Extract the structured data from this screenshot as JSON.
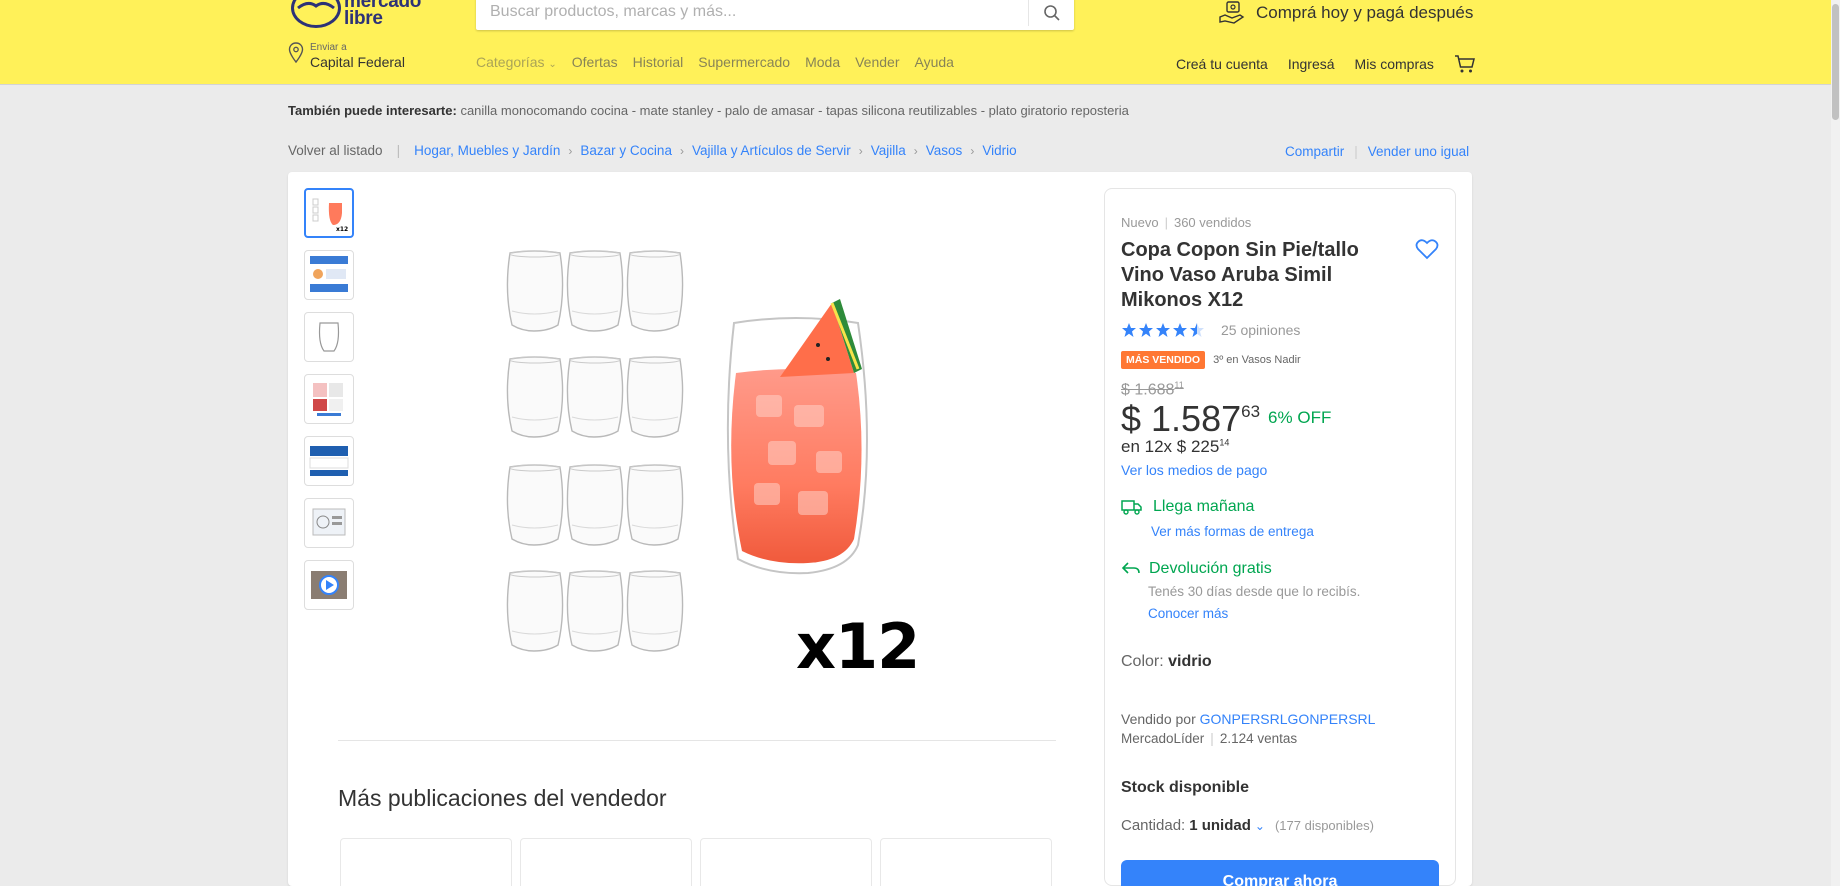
{
  "header": {
    "logo_text_line1": "mercado",
    "logo_text_line2": "libre",
    "search_placeholder": "Buscar productos, marcas y más...",
    "promo": "Comprá hoy y pagá después",
    "location_small": "Enviar a",
    "location_big": "Capital Federal",
    "nav": [
      "Categorías",
      "Ofertas",
      "Historial",
      "Supermercado",
      "Moda",
      "Vender",
      "Ayuda"
    ],
    "user_nav": [
      "Creá tu cuenta",
      "Ingresá",
      "Mis compras"
    ],
    "brand_color": "#fff159"
  },
  "suggestions": {
    "label": "También puede interesarte:",
    "items": "canilla monocomando cocina - mate stanley - palo de amasar - tapas silicona reutilizables - plato giratorio reposteria"
  },
  "breadcrumb": {
    "back": "Volver al listado",
    "items": [
      "Hogar, Muebles y Jardín",
      "Bazar y Cocina",
      "Vajilla y Artículos de Servir",
      "Vajilla",
      "Vasos",
      "Vidrio"
    ],
    "share": "Compartir",
    "sell": "Vender uno igual"
  },
  "gallery": {
    "badge_text": "x12"
  },
  "more": {
    "title": "Más publicaciones del vendedor"
  },
  "product": {
    "condition": "Nuevo",
    "sold": "360 vendidos",
    "title": "Copa Copon Sin Pie/tallo Vino Vaso Aruba Simil Mikonos X12",
    "rating": 4.5,
    "reviews": "25 opiniones",
    "badge": "MÁS VENDIDO",
    "rank": "3º en Vasos Nadir",
    "old_price": "$ 1.688",
    "old_price_cents": "11",
    "price": "$ 1.587",
    "price_cents": "63",
    "discount": "6% OFF",
    "installments": "en 12x $ 225",
    "installments_cents": "14",
    "payment_link": "Ver los medios de pago",
    "shipping": "Llega mañana",
    "shipping_link": "Ver más formas de entrega",
    "return_title": "Devolución gratis",
    "return_sub": "Tenés 30 días desde que lo recibís.",
    "return_link": "Conocer más",
    "color_label": "Color:",
    "color_value": "vidrio",
    "seller_label": "Vendido por",
    "seller_name": "GONPERSRLGONPERSRL",
    "seller_tag": "MercadoLíder",
    "seller_sales": "2.124 ventas",
    "stock": "Stock disponible",
    "qty_label": "Cantidad:",
    "qty_value": "1 unidad",
    "qty_available": "(177 disponibles)",
    "buy_button": "Comprar ahora",
    "accent": "#3483fa",
    "success": "#00a650"
  }
}
